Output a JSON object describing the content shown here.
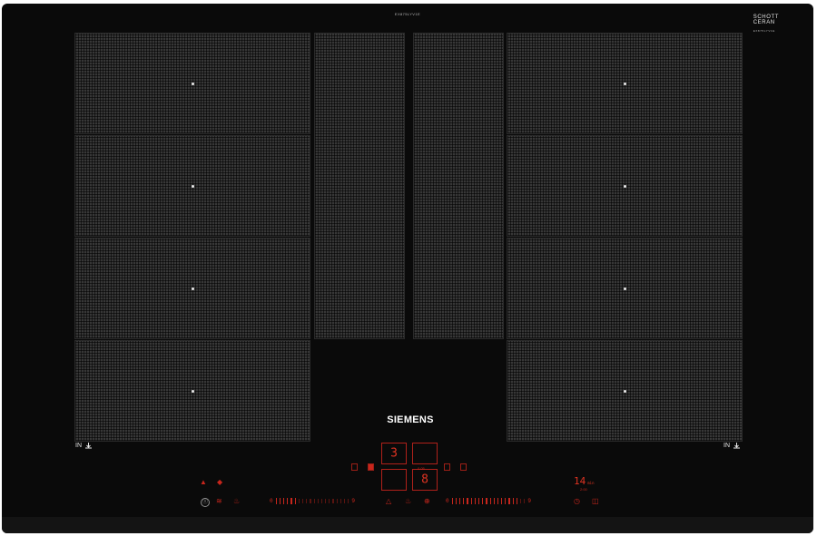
{
  "device": {
    "model_label": "EX875LYV1E",
    "glass_brand": [
      "SCHOTT",
      "CERAN"
    ],
    "glass_small": "EX875LYV1E",
    "brand": "SIEMENS"
  },
  "zones": {
    "left_flex": [
      "zone",
      "zone",
      "zone",
      "zone"
    ],
    "right_flex": [
      "zone",
      "zone",
      "zone",
      "zone"
    ],
    "center": [
      "zone",
      "zone"
    ]
  },
  "labels": {
    "in_left": "IN",
    "in_right": "IN"
  },
  "display": {
    "upper_left_digit": "3",
    "upper_right_digit": "",
    "lower_left_digit": "",
    "lower_right_digit": "8",
    "mini_label": "0.05",
    "timer_value": "14",
    "timer_unit": "min",
    "timer_sub": "2:00"
  },
  "sliders": {
    "left": {
      "start": "0",
      "end": "9",
      "active_ticks": 6,
      "total_ticks": 20
    },
    "right": {
      "start": "0",
      "end": "9",
      "active_ticks": 18,
      "total_ticks": 20
    }
  },
  "controls": {
    "power": "Ⓘ",
    "left_icons": [
      "≋",
      "♨"
    ],
    "mid_icons": [
      "△",
      "♨",
      "⊕"
    ],
    "right_icons": [
      "◷",
      "◫"
    ]
  },
  "colors": {
    "accent_red": "#c8261c",
    "glass": "#0a0a0a",
    "zone_grid": "#373737"
  }
}
